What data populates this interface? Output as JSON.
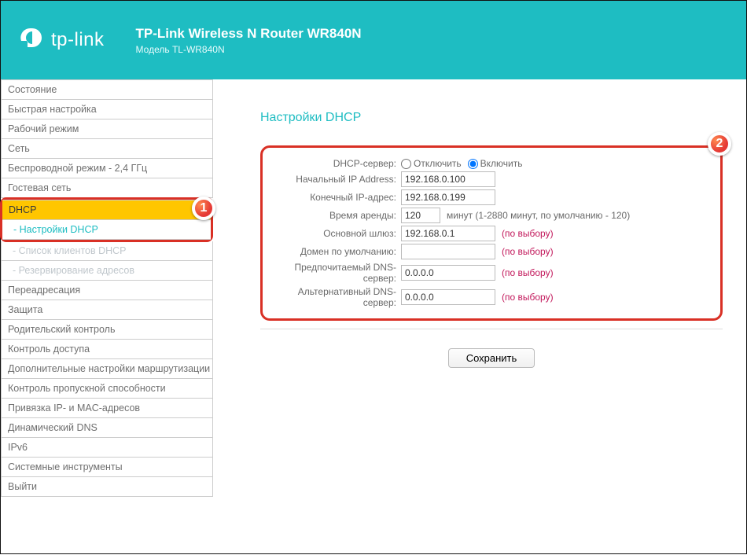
{
  "header": {
    "brand": "tp-link",
    "title": "TP-Link Wireless N Router WR840N",
    "subtitle": "Модель TL-WR840N"
  },
  "sidebar": {
    "items": [
      "Состояние",
      "Быстрая настройка",
      "Рабочий режим",
      "Сеть",
      "Беспроводной режим - 2,4 ГГц",
      "Гостевая сеть"
    ],
    "dhcp_label": "DHCP",
    "dhcp_sub": [
      "- Настройки DHCP",
      "- Список клиентов DHCP",
      "- Резервирование адресов"
    ],
    "items2": [
      "Переадресация",
      "Защита",
      "Родительский контроль",
      "Контроль доступа",
      "Дополнительные настройки маршрутизации",
      "Контроль пропускной способности",
      "Привязка IP- и MAC-адресов",
      "Динамический DNS",
      "IPv6",
      "Системные инструменты",
      "Выйти"
    ]
  },
  "page": {
    "title": "Настройки DHCP",
    "labels": {
      "server": "DHCP-сервер:",
      "disable": "Отключить",
      "enable": "Включить",
      "start_ip": "Начальный IP Address:",
      "end_ip": "Конечный IP-адрес:",
      "lease": "Время аренды:",
      "lease_hint": "минут (1-2880 минут, по умолчанию - 120)",
      "gateway": "Основной шлюз:",
      "domain": "Домен по умолчанию:",
      "dns1": "Предпочитаемый DNS-сервер:",
      "dns2": "Альтернативный DNS-сервер:",
      "optional": "(по выбору)"
    },
    "values": {
      "server_enabled": "on",
      "start_ip": "192.168.0.100",
      "end_ip": "192.168.0.199",
      "lease": "120",
      "gateway": "192.168.0.1",
      "domain": "",
      "dns1": "0.0.0.0",
      "dns2": "0.0.0.0"
    },
    "save": "Сохранить"
  },
  "callouts": {
    "one": "1",
    "two": "2"
  }
}
